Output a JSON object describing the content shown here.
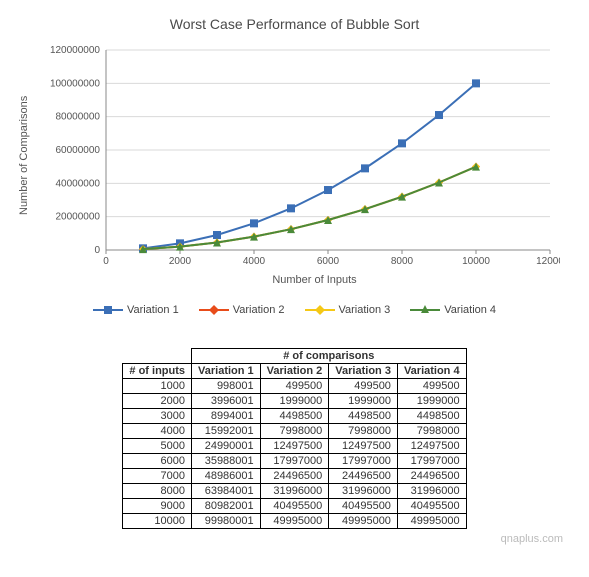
{
  "chart_data": {
    "type": "line",
    "title": "Worst Case Performance of Bubble Sort",
    "xlabel": "Number of Inputs",
    "ylabel": "Number of Comparisons",
    "xlim": [
      0,
      12000
    ],
    "ylim": [
      0,
      120000000
    ],
    "xticks": [
      0,
      2000,
      4000,
      6000,
      8000,
      10000,
      12000
    ],
    "yticks": [
      0,
      20000000,
      40000000,
      60000000,
      80000000,
      100000000,
      120000000
    ],
    "x": [
      1000,
      2000,
      3000,
      4000,
      5000,
      6000,
      7000,
      8000,
      9000,
      10000
    ],
    "series": [
      {
        "name": "Variation 1",
        "color": "#3b6fb6",
        "marker": "square",
        "values": [
          998001,
          3996001,
          8994001,
          15992001,
          24990001,
          35988001,
          48986001,
          63984001,
          80982001,
          99980001
        ]
      },
      {
        "name": "Variation 2",
        "color": "#e84c1a",
        "marker": "diamond",
        "values": [
          499500,
          1999000,
          4498500,
          7998000,
          12497500,
          17997000,
          24496500,
          31996000,
          40495500,
          49995000
        ]
      },
      {
        "name": "Variation 3",
        "color": "#f5c816",
        "marker": "diamond",
        "values": [
          499500,
          1999000,
          4498500,
          7998000,
          12497500,
          17997000,
          24496500,
          31996000,
          40495500,
          49995000
        ]
      },
      {
        "name": "Variation 4",
        "color": "#4a8a3a",
        "marker": "triangle",
        "values": [
          499500,
          1999000,
          4498500,
          7998000,
          12497500,
          17997000,
          24496500,
          31996000,
          40495500,
          49995000
        ]
      }
    ]
  },
  "table": {
    "top_header": "# of comparisons",
    "col0_header": "# of inputs",
    "columns": [
      "Variation 1",
      "Variation 2",
      "Variation 3",
      "Variation 4"
    ],
    "rows": [
      [
        1000,
        998001,
        499500,
        499500,
        499500
      ],
      [
        2000,
        3996001,
        1999000,
        1999000,
        1999000
      ],
      [
        3000,
        8994001,
        4498500,
        4498500,
        4498500
      ],
      [
        4000,
        15992001,
        7998000,
        7998000,
        7998000
      ],
      [
        5000,
        24990001,
        12497500,
        12497500,
        12497500
      ],
      [
        6000,
        35988001,
        17997000,
        17997000,
        17997000
      ],
      [
        7000,
        48986001,
        24496500,
        24496500,
        24496500
      ],
      [
        8000,
        63984001,
        31996000,
        31996000,
        31996000
      ],
      [
        9000,
        80982001,
        40495500,
        40495500,
        40495500
      ],
      [
        10000,
        99980001,
        49995000,
        49995000,
        49995000
      ]
    ]
  },
  "watermark": "qnaplus.com"
}
